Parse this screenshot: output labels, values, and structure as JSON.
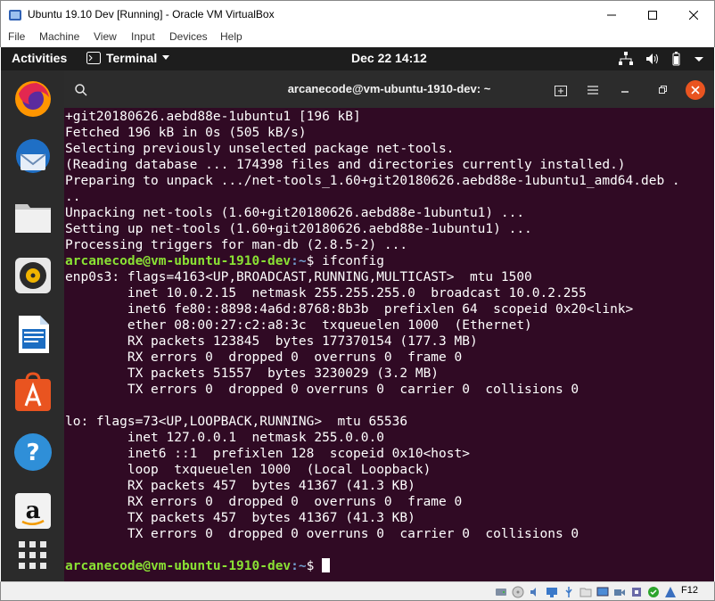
{
  "window": {
    "title": "Ubuntu 19.10 Dev [Running] - Oracle VM VirtualBox"
  },
  "menubar": {
    "items": [
      "File",
      "Machine",
      "View",
      "Input",
      "Devices",
      "Help"
    ]
  },
  "topbar": {
    "activities": "Activities",
    "app_menu": "Terminal",
    "clock": "Dec 22  14:12"
  },
  "dock": {
    "items": [
      "firefox-icon",
      "thunderbird-icon",
      "files-icon",
      "rhythmbox-icon",
      "libreoffice-writer-icon",
      "ubuntu-software-icon",
      "help-icon",
      "amazon-icon",
      "show-applications-icon"
    ]
  },
  "terminal": {
    "title": "arcanecode@vm-ubuntu-1910-dev: ~",
    "lines": [
      "+git20180626.aebd88e-1ubuntu1 [196 kB]",
      "Fetched 196 kB in 0s (505 kB/s)",
      "Selecting previously unselected package net-tools.",
      "(Reading database ... 174398 files and directories currently installed.)",
      "Preparing to unpack .../net-tools_1.60+git20180626.aebd88e-1ubuntu1_amd64.deb .",
      "..",
      "Unpacking net-tools (1.60+git20180626.aebd88e-1ubuntu1) ...",
      "Setting up net-tools (1.60+git20180626.aebd88e-1ubuntu1) ...",
      "Processing triggers for man-db (2.8.5-2) ..."
    ],
    "prompt_user": "arcanecode@vm-ubuntu-1910-dev",
    "prompt_path": ":~",
    "prompt_symbol": "$",
    "command": " ifconfig",
    "output": [
      "enp0s3: flags=4163<UP,BROADCAST,RUNNING,MULTICAST>  mtu 1500",
      "        inet 10.0.2.15  netmask 255.255.255.0  broadcast 10.0.2.255",
      "        inet6 fe80::8898:4a6d:8768:8b3b  prefixlen 64  scopeid 0x20<link>",
      "        ether 08:00:27:c2:a8:3c  txqueuelen 1000  (Ethernet)",
      "        RX packets 123845  bytes 177370154 (177.3 MB)",
      "        RX errors 0  dropped 0  overruns 0  frame 0",
      "        TX packets 51557  bytes 3230029 (3.2 MB)",
      "        TX errors 0  dropped 0 overruns 0  carrier 0  collisions 0",
      "",
      "lo: flags=73<UP,LOOPBACK,RUNNING>  mtu 65536",
      "        inet 127.0.0.1  netmask 255.0.0.0",
      "        inet6 ::1  prefixlen 128  scopeid 0x10<host>",
      "        loop  txqueuelen 1000  (Local Loopback)",
      "        RX packets 457  bytes 41367 (41.3 KB)",
      "        RX errors 0  dropped 0  overruns 0  frame 0",
      "        TX packets 457  bytes 41367 (41.3 KB)",
      "        TX errors 0  dropped 0 overruns 0  carrier 0  collisions 0",
      ""
    ]
  },
  "status": {
    "host_key": "F12"
  },
  "colors": {
    "terminal_bg": "#300a24",
    "prompt_user": "#8ae234",
    "prompt_path": "#729fcf",
    "close_button": "#e95420"
  }
}
